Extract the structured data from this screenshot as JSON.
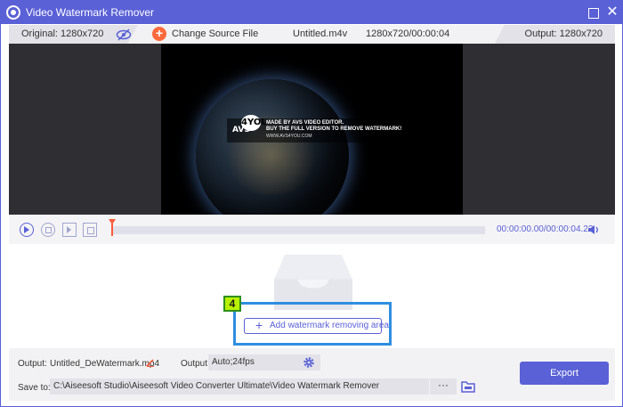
{
  "window": {
    "title": "Video Watermark Remover",
    "maximize_glyph": "",
    "close_glyph": "✕"
  },
  "infobar": {
    "original": "Original: 1280x720",
    "change_source": "Change Source File",
    "filename": "Untitled.m4v",
    "file_meta": "1280x720/00:00:04",
    "output": "Output: 1280x720"
  },
  "watermark": {
    "line1": "MADE BY AVS VIDEO EDITOR.",
    "line2": "BUY THE FULL VERSION TO REMOVE WATERMARK!",
    "line3": "WWW.AVS4YOU.COM",
    "logo_num": "4YOU",
    "logo_avs": "AVS"
  },
  "controls": {
    "time": "00:00:00.00/00:00:04.23",
    "playhead_fraction": 0.0
  },
  "work": {
    "step_number": "4",
    "add_area_label": "Add watermark removing area",
    "plus_glyph": "+"
  },
  "bottom": {
    "output_label": "Output:",
    "output_file": "Untitled_DeWatermark.mp4",
    "output_format_label": "Output:",
    "output_format": "Auto;24fps",
    "save_label": "Save to:",
    "save_path": "C:\\Aiseesoft Studio\\Aiseesoft Video Converter Ultimate\\Video Watermark Remover",
    "more_glyph": "···",
    "export_label": "Export"
  },
  "colors": {
    "accent": "#5a60d6",
    "highlight": "#2f8ee0",
    "badge": "#b8f000",
    "playhead": "#ff5a3c",
    "change_source_icon": "#ff6a3d"
  }
}
